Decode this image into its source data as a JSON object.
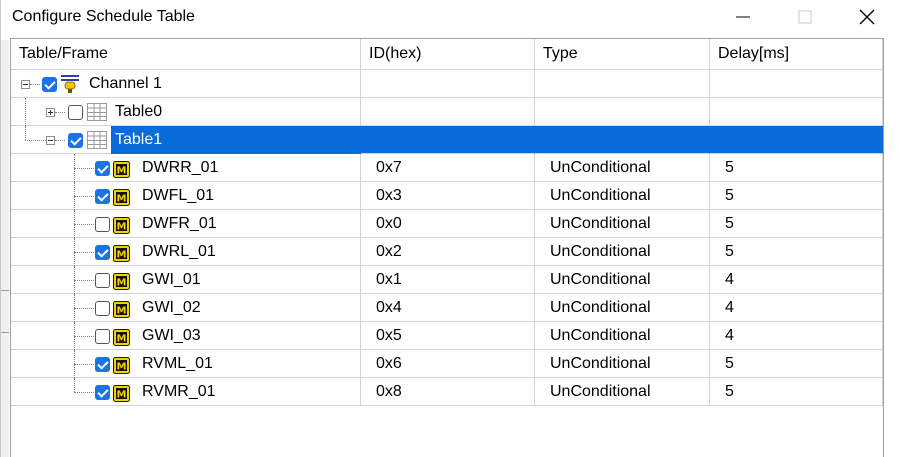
{
  "window": {
    "title": "Configure Schedule Table"
  },
  "columns": [
    "Table/Frame",
    "ID(hex)",
    "Type",
    "Delay[ms]"
  ],
  "tree": {
    "channel": {
      "label": "Channel 1",
      "checked": true,
      "expanded": true
    },
    "tables": [
      {
        "label": "Table0",
        "checked": false,
        "expanded": false,
        "selected": false
      },
      {
        "label": "Table1",
        "checked": true,
        "expanded": true,
        "selected": true
      }
    ],
    "frames": [
      {
        "name": "DWRR_01",
        "id": "0x7",
        "type": "UnConditional",
        "delay": "5",
        "checked": true
      },
      {
        "name": "DWFL_01",
        "id": "0x3",
        "type": "UnConditional",
        "delay": "5",
        "checked": true
      },
      {
        "name": "DWFR_01",
        "id": "0x0",
        "type": "UnConditional",
        "delay": "5",
        "checked": false
      },
      {
        "name": "DWRL_01",
        "id": "0x2",
        "type": "UnConditional",
        "delay": "5",
        "checked": true
      },
      {
        "name": "GWI_01",
        "id": "0x1",
        "type": "UnConditional",
        "delay": "4",
        "checked": false
      },
      {
        "name": "GWI_02",
        "id": "0x4",
        "type": "UnConditional",
        "delay": "4",
        "checked": false
      },
      {
        "name": "GWI_03",
        "id": "0x5",
        "type": "UnConditional",
        "delay": "4",
        "checked": false
      },
      {
        "name": "RVML_01",
        "id": "0x6",
        "type": "UnConditional",
        "delay": "5",
        "checked": true
      },
      {
        "name": "RVMR_01",
        "id": "0x8",
        "type": "UnConditional",
        "delay": "5",
        "checked": true
      }
    ]
  },
  "icons": {
    "channel": "channel-icon",
    "table": "table-icon",
    "frame": "frame-m-icon"
  },
  "colors": {
    "selection": "#0a6cd8",
    "checkbox_checked": "#1a73e8",
    "frame_icon": "#f5d000"
  }
}
